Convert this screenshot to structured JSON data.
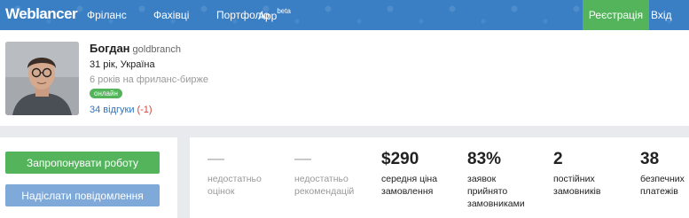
{
  "nav": {
    "logo": "Weblancer",
    "items": [
      {
        "label": "Фріланс"
      },
      {
        "label": "Фахівці"
      },
      {
        "label": "Портфоліо"
      },
      {
        "label": "App",
        "sup": "beta"
      }
    ],
    "register": "Реєстрація",
    "login": "Вхід",
    "colors": {
      "bar": "#3a7fc4",
      "register": "#54b45c"
    }
  },
  "profile": {
    "name": "Богдан",
    "login": "goldbranch",
    "age_location": "31 рік, Україна",
    "freelance_years": "6 років на фриланс-бирже",
    "status": "онлайн",
    "reviews_text": "34 відгуки",
    "reviews_negative": "(-1)"
  },
  "actions": {
    "offer_job": "Запропонувати роботу",
    "send_message": "Надіслати повідомлення"
  },
  "stats": [
    {
      "value": "—",
      "label_lines": [
        "недостатньо",
        "оцінок"
      ],
      "muted": true
    },
    {
      "value": "—",
      "label_lines": [
        "недостатньо",
        "рекомендацій"
      ],
      "muted": true
    },
    {
      "value": "$290",
      "label_lines": [
        "середня ціна",
        "замовлення"
      ],
      "muted": false
    },
    {
      "value": "83%",
      "label_lines": [
        "заявок",
        "прийнято",
        "замовниками"
      ],
      "muted": false
    },
    {
      "value": "2",
      "label_lines": [
        "постійних",
        "замовників"
      ],
      "muted": false
    },
    {
      "value": "38",
      "label_lines": [
        "безпечних",
        "платежів"
      ],
      "muted": false
    }
  ]
}
